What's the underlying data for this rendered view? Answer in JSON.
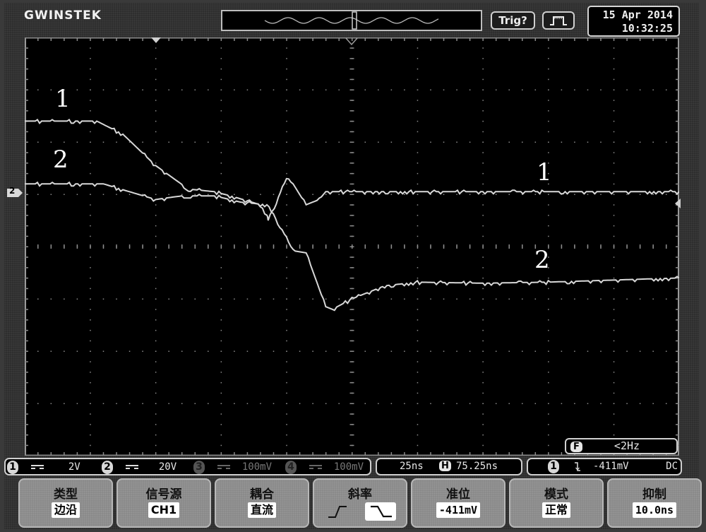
{
  "header": {
    "brand": "GWINSTEK",
    "trig_status_label": "Trig?",
    "run_mode_icon": "pulse-run-icon",
    "date": "15 Apr 2014",
    "time": "10:32:25"
  },
  "screen": {
    "divisions": {
      "horizontal": 10,
      "vertical": 8
    },
    "ch2_marker_label": "2",
    "trace_labels": [
      {
        "id": "ch1-left",
        "text": "1"
      },
      {
        "id": "ch2-left",
        "text": "2"
      },
      {
        "id": "ch1-right",
        "text": "1"
      },
      {
        "id": "ch2-right",
        "text": "2"
      }
    ],
    "frequency": {
      "badge": "F",
      "value": "<2Hz"
    },
    "traces": {
      "x_divs": [
        0,
        1.1,
        1.5,
        2.0,
        2.5,
        2.9,
        3.2,
        3.6,
        3.7,
        3.72,
        4.0,
        4.1,
        4.3,
        4.5,
        4.6,
        5.0,
        10
      ],
      "ch1_divs": [
        2.4,
        2.4,
        2.15,
        1.55,
        1.1,
        1.05,
        0.95,
        0.8,
        0.6,
        0.5,
        1.3,
        1.2,
        0.8,
        0.9,
        1.05,
        1.05,
        1.05
      ],
      "ch2_x_divs": [
        0,
        1.2,
        1.6,
        2.0,
        2.4,
        2.9,
        3.3,
        3.7,
        3.9,
        4.1,
        4.3,
        4.6,
        4.7,
        5.0,
        5.5,
        6.0,
        7.0,
        8.0,
        10
      ],
      "ch2_divs": [
        1.2,
        1.2,
        1.05,
        0.9,
        0.97,
        0.97,
        0.85,
        0.8,
        0.4,
        -0.08,
        -0.12,
        -1.15,
        -1.2,
        -1.0,
        -0.75,
        -0.68,
        -0.7,
        -0.68,
        -0.6
      ]
    }
  },
  "status": {
    "channels": [
      {
        "num": "1",
        "coupling": "DC",
        "scale": "2V",
        "active": true
      },
      {
        "num": "2",
        "coupling": "DC",
        "scale": "20V",
        "active": true
      },
      {
        "num": "3",
        "coupling": "DC",
        "scale": "100mV",
        "active": false
      },
      {
        "num": "4",
        "coupling": "DC",
        "scale": "100mV",
        "active": false
      }
    ],
    "timebase": "25ns",
    "h_badge": "H",
    "h_position": "75.25ns",
    "trigger": {
      "source": "1",
      "slope_icon": "falling-edge-icon",
      "level": "-411mV",
      "coupling": "DC"
    }
  },
  "softkeys": [
    {
      "title": "类型",
      "value": "边沿"
    },
    {
      "title": "信号源",
      "value": "CH1"
    },
    {
      "title": "耦合",
      "value": "直流"
    },
    {
      "title": "斜率",
      "options": [
        "rising",
        "falling"
      ],
      "selected": "falling"
    },
    {
      "title": "准位",
      "value": "-411mV"
    },
    {
      "title": "模式",
      "value": "正常"
    },
    {
      "title": "抑制",
      "value": "10.0ns"
    }
  ],
  "colors": {
    "trace": "#d8d8d8",
    "grid": "#8c8c8c",
    "screen_bg": "#000000",
    "bezel": "#2e2e2e",
    "softkey": "#8a8a8a"
  }
}
